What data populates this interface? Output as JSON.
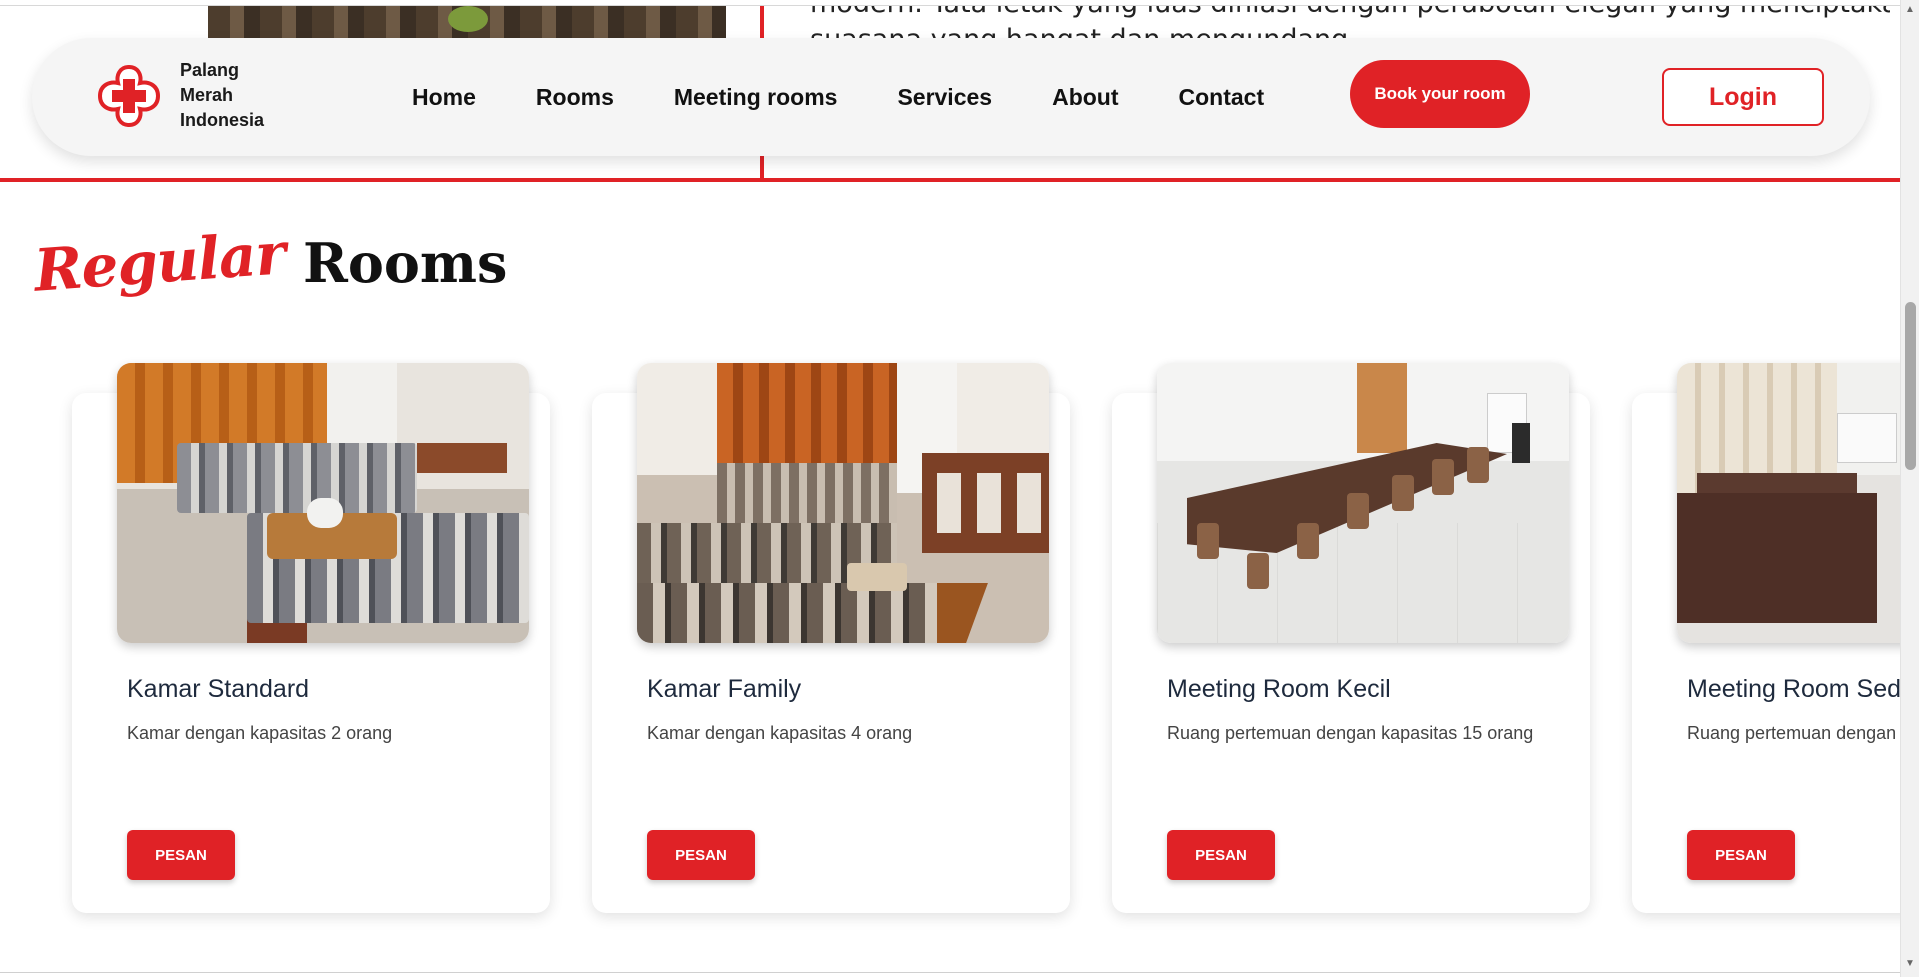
{
  "hero": {
    "text_line1": "modern. Tata letak yang luas dihiasi dengan perabotan elegan yang menciptakan",
    "text_line2": "suasana yang hangat dan mengundang"
  },
  "nav": {
    "brand_line1": "Palang",
    "brand_line2": "Merah",
    "brand_line3": "Indonesia",
    "links": [
      "Home",
      "Rooms",
      "Meeting rooms",
      "Services",
      "About",
      "Contact"
    ],
    "book_label": "Book your room",
    "login_label": "Login"
  },
  "section": {
    "title_script": "Regular",
    "title_main": "Rooms"
  },
  "cards": [
    {
      "title": "Kamar Standard",
      "desc": "Kamar dengan kapasitas 2 orang",
      "button": "PESAN"
    },
    {
      "title": "Kamar Family",
      "desc": "Kamar dengan kapasitas 4 orang",
      "button": "PESAN"
    },
    {
      "title": "Meeting Room Kecil",
      "desc": "Ruang pertemuan dengan kapasitas 15 orang",
      "button": "PESAN"
    },
    {
      "title": "Meeting Room Sedang",
      "desc": "Ruang pertemuan dengan kapasitas",
      "button": "PESAN"
    }
  ],
  "colors": {
    "brand_red": "#e02226",
    "navbar_bg": "#f5f5f5"
  },
  "icons": {
    "logo": "red-cross-flower-logo",
    "scroll_up": "triangle-up-icon",
    "scroll_down": "triangle-down-icon"
  }
}
